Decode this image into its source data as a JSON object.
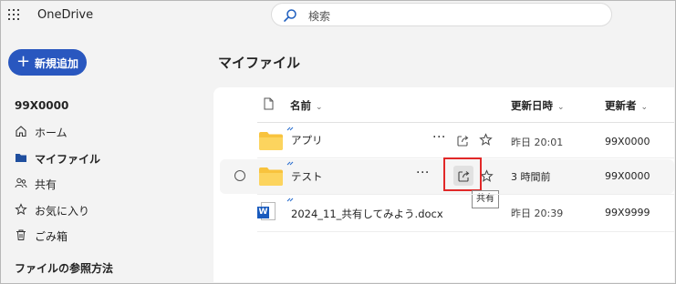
{
  "app": {
    "name": "OneDrive"
  },
  "search": {
    "placeholder": "検索"
  },
  "sidebar": {
    "new_button": "新規追加",
    "user": "99X0000",
    "items": [
      {
        "label": "ホーム",
        "icon": "home-icon"
      },
      {
        "label": "マイファイル",
        "icon": "folder-icon",
        "selected": true
      },
      {
        "label": "共有",
        "icon": "people-icon"
      },
      {
        "label": "お気に入り",
        "icon": "star-icon"
      },
      {
        "label": "ごみ箱",
        "icon": "trash-icon"
      }
    ],
    "section_title": "ファイルの参照方法"
  },
  "main": {
    "title": "マイファイル",
    "columns": {
      "name": "名前",
      "modified": "更新日時",
      "modified_by": "更新者"
    },
    "rows": [
      {
        "name": "アプリ",
        "type": "folder",
        "modified": "昨日 20:01",
        "modified_by": "99X0000"
      },
      {
        "name": "テスト",
        "type": "folder",
        "modified": "3 時間前",
        "modified_by": "99X0000",
        "hovered": true
      },
      {
        "name": "2024_11_共有してみよう.docx",
        "type": "word",
        "modified": "昨日 20:39",
        "modified_by": "99X9999"
      }
    ],
    "more_label": "···",
    "share_tooltip": "共有"
  },
  "colors": {
    "accent": "#2957bf",
    "folder": "#f8c33d",
    "highlight": "#e12828",
    "word": "#185abd"
  }
}
